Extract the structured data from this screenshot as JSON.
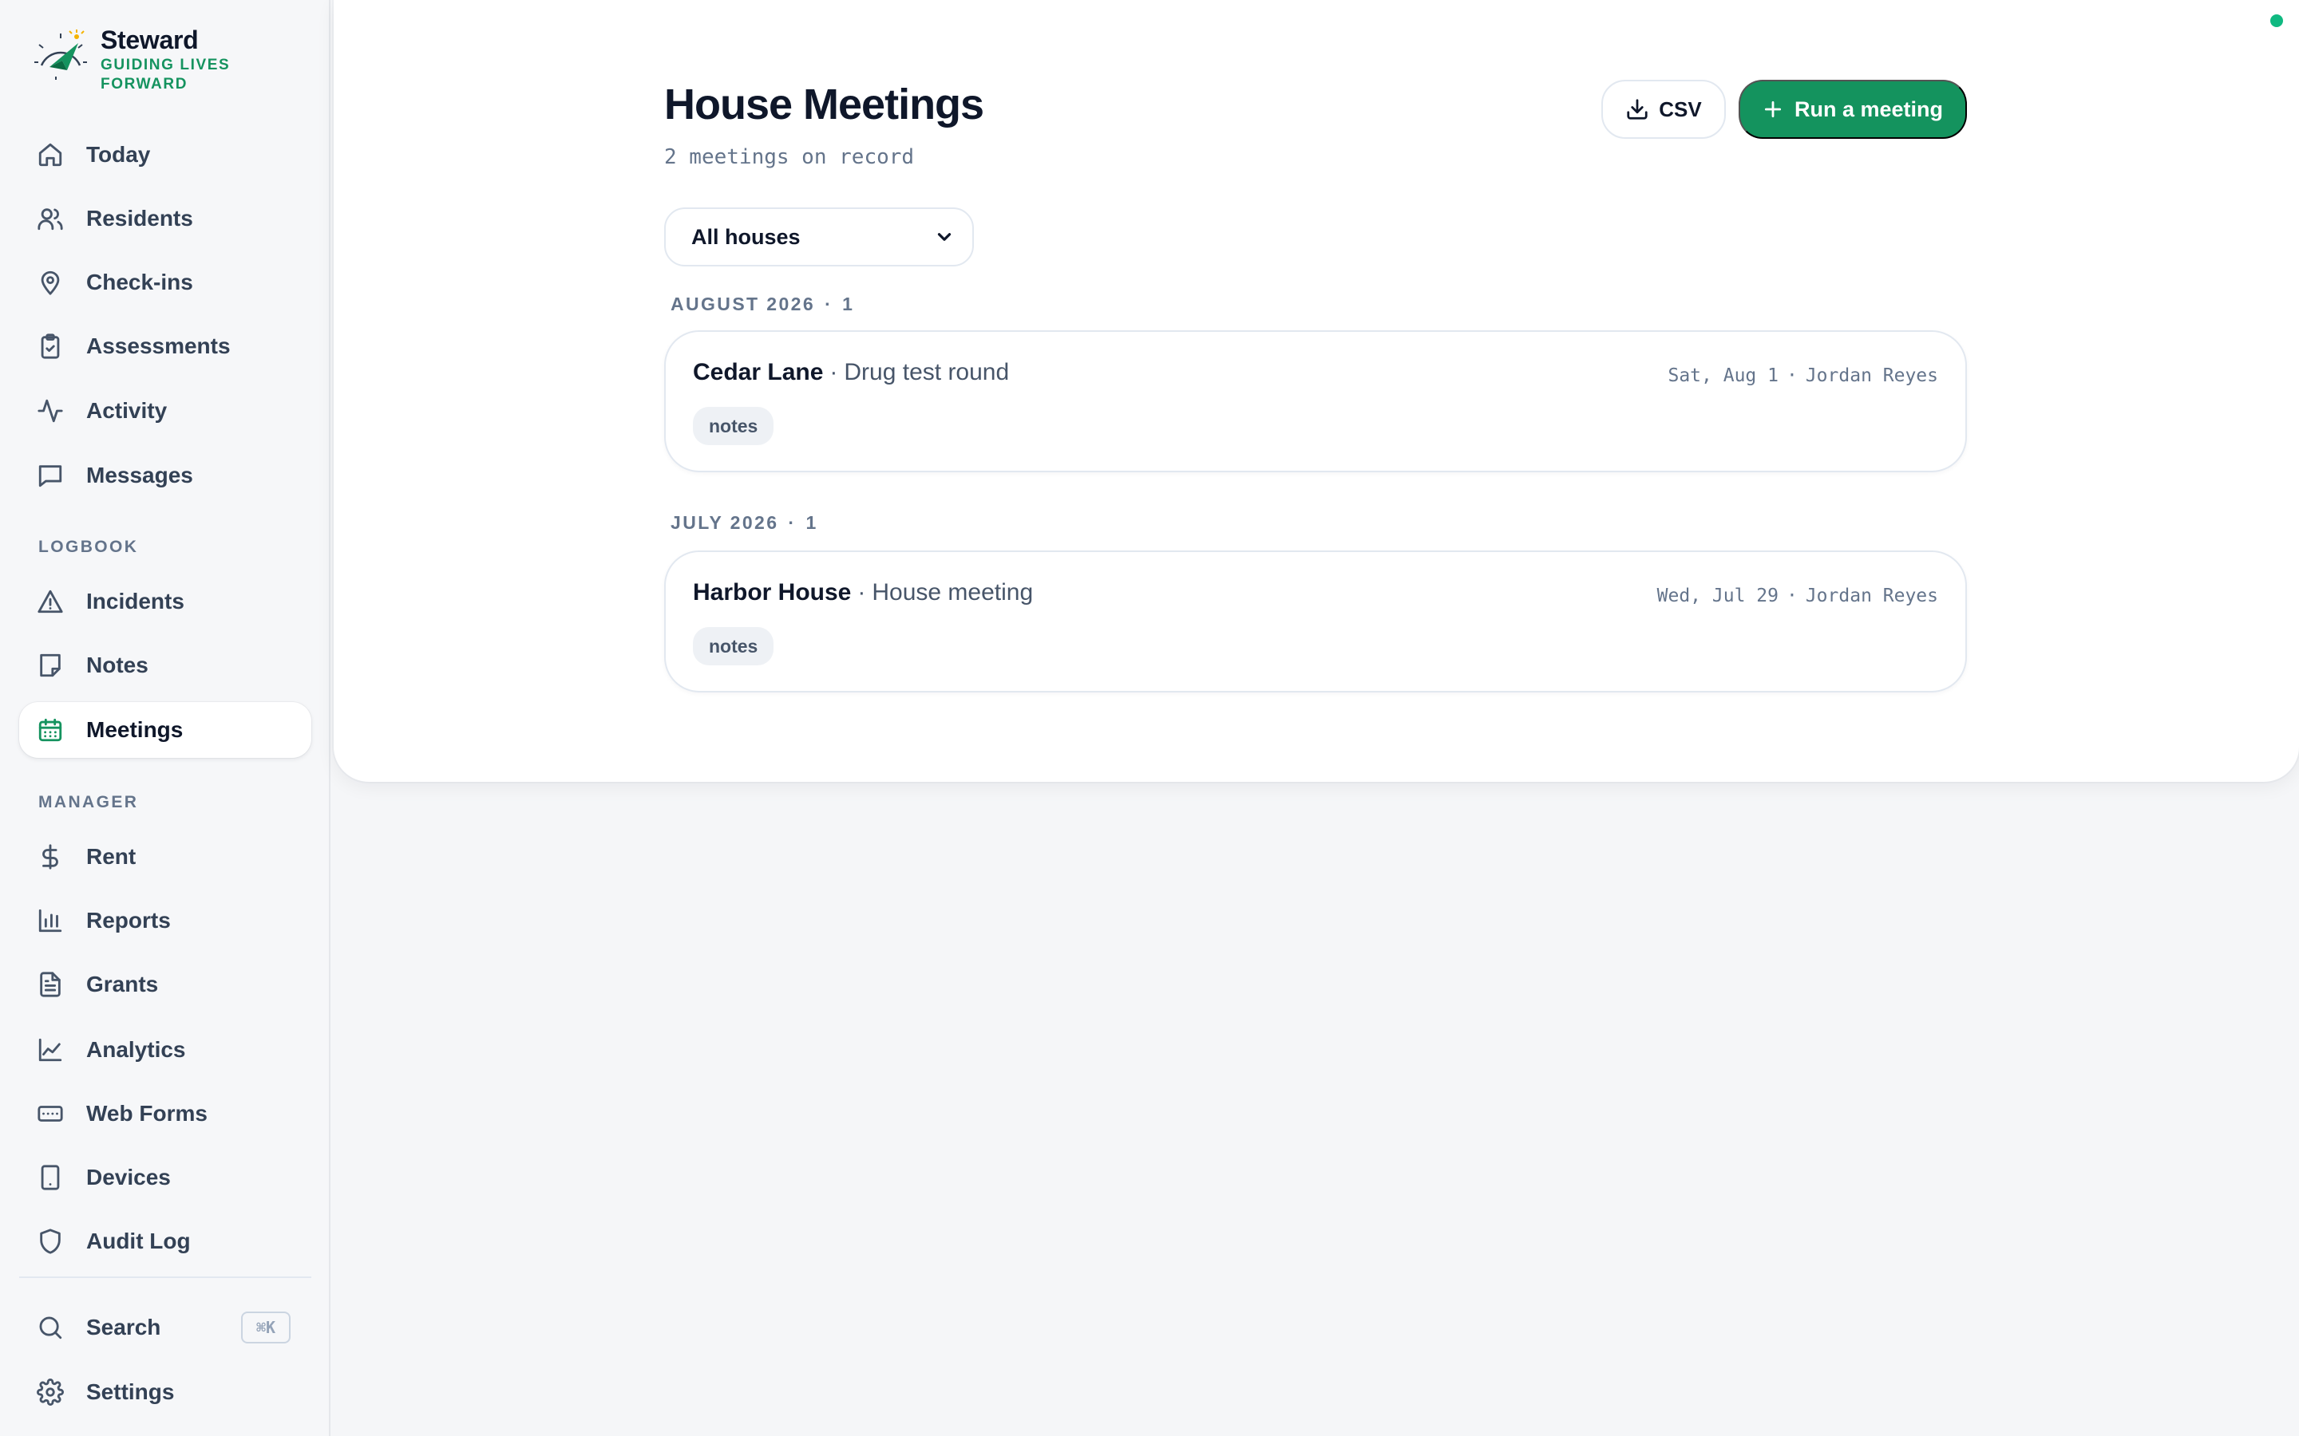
{
  "brand": {
    "name": "Steward",
    "tagline": "GUIDING LIVES FORWARD"
  },
  "sidebar": {
    "primary": [
      {
        "label": "Today",
        "icon": "home-icon"
      },
      {
        "label": "Residents",
        "icon": "users-icon"
      },
      {
        "label": "Check-ins",
        "icon": "map-pin-icon"
      },
      {
        "label": "Assessments",
        "icon": "clipboard-check-icon"
      },
      {
        "label": "Activity",
        "icon": "activity-icon"
      },
      {
        "label": "Messages",
        "icon": "message-square-icon"
      }
    ],
    "logbook_label": "LOGBOOK",
    "logbook": [
      {
        "label": "Incidents",
        "icon": "alert-triangle-icon"
      },
      {
        "label": "Notes",
        "icon": "sticky-note-icon"
      },
      {
        "label": "Meetings",
        "icon": "calendar-icon",
        "active": true
      }
    ],
    "manager_label": "MANAGER",
    "manager": [
      {
        "label": "Rent",
        "icon": "dollar-sign-icon"
      },
      {
        "label": "Reports",
        "icon": "bar-chart-icon"
      },
      {
        "label": "Grants",
        "icon": "file-text-icon"
      },
      {
        "label": "Analytics",
        "icon": "line-chart-icon"
      },
      {
        "label": "Web Forms",
        "icon": "form-input-icon"
      },
      {
        "label": "Devices",
        "icon": "tablet-icon"
      },
      {
        "label": "Audit Log",
        "icon": "shield-icon"
      }
    ],
    "footer": {
      "search_label": "Search",
      "search_shortcut": "⌘K",
      "settings_label": "Settings"
    }
  },
  "page": {
    "title": "House Meetings",
    "subtitle": "2 meetings on record",
    "csv_label": "CSV",
    "run_label": "Run a meeting",
    "filter_value": "All houses"
  },
  "groups": [
    {
      "label": "AUGUST 2026",
      "count": "1",
      "meetings": [
        {
          "house": "Cedar Lane",
          "type": "Drug test round",
          "date": "Sat, Aug 1",
          "leader": "Jordan Reyes",
          "tag": "notes"
        }
      ]
    },
    {
      "label": "JULY 2026",
      "count": "1",
      "meetings": [
        {
          "house": "Harbor House",
          "type": "House meeting",
          "date": "Wed, Jul 29",
          "leader": "Jordan Reyes",
          "tag": "notes"
        }
      ]
    }
  ],
  "colors": {
    "accent": "#14935e",
    "status_online": "#10b981"
  }
}
